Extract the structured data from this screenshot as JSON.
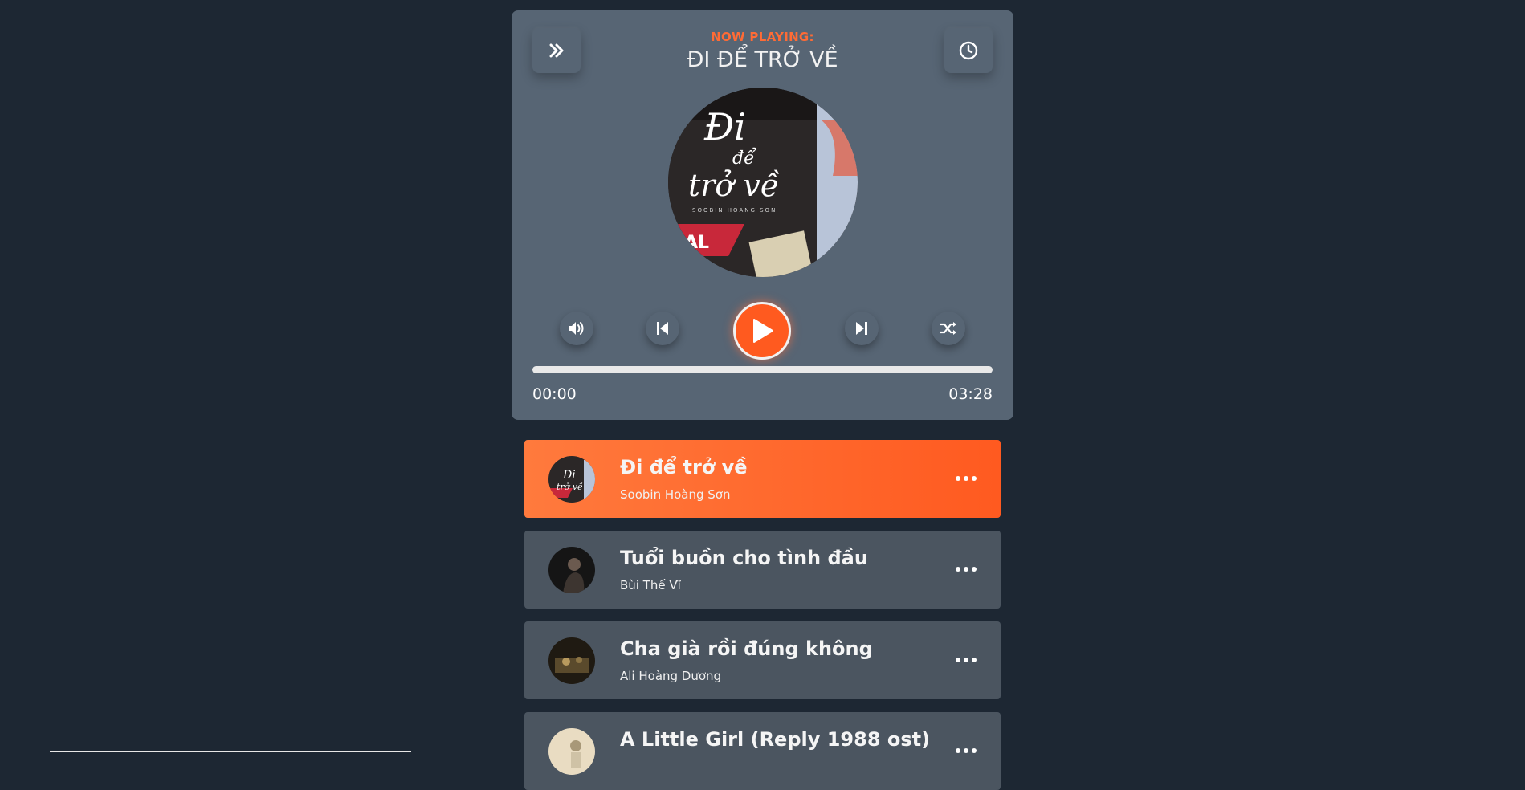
{
  "colors": {
    "page_bg": "#1d2733",
    "panel_bg": "#576574",
    "accent": "#ff5a1f",
    "song_bg": "#4b5560"
  },
  "player": {
    "now_playing_label": "NOW PLAYING:",
    "title": "ĐI ĐỂ TRỞ VỀ",
    "left_button_icon": "chevrons-right-icon",
    "right_button_icon": "clock-icon",
    "time_current": "00:00",
    "time_total": "03:28",
    "progress_fraction": 0.0,
    "controls": {
      "volume_icon": "volume-icon",
      "prev_icon": "skip-back-icon",
      "play_icon": "play-icon",
      "next_icon": "skip-forward-icon",
      "shuffle_icon": "shuffle-icon"
    }
  },
  "playlist": [
    {
      "title": "Đi để trở về",
      "artist": "Soobin Hoàng Sơn",
      "active": true
    },
    {
      "title": "Tuổi buồn cho tình đầu",
      "artist": "Bùi Thế Vĩ",
      "active": false
    },
    {
      "title": "Cha già rồi đúng không",
      "artist": "Ali Hoàng Dương",
      "active": false
    },
    {
      "title": "A Little Girl (Reply 1988 ost)",
      "artist": "",
      "active": false
    }
  ]
}
